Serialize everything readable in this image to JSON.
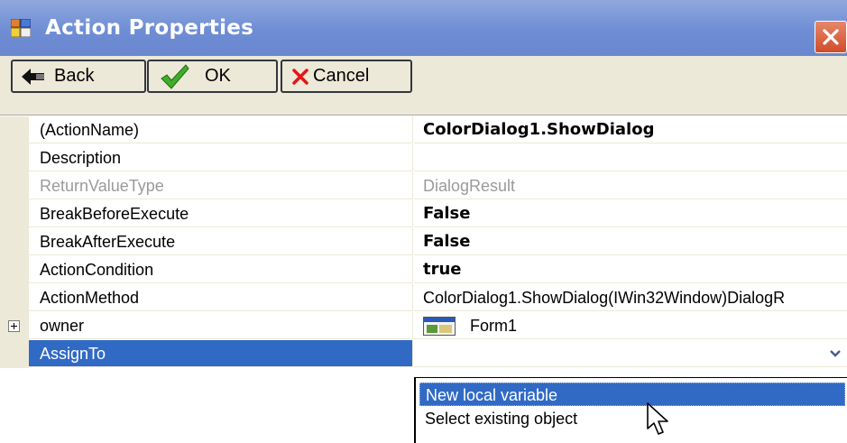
{
  "window": {
    "title": "Action Properties",
    "accent": "#316ac5"
  },
  "toolbar": {
    "back_label": "Back",
    "ok_label": "OK",
    "cancel_label": "Cancel"
  },
  "properties": [
    {
      "name": "(ActionName)",
      "value": "ColorDialog1.ShowDialog"
    },
    {
      "name": "Description",
      "value": ""
    },
    {
      "name": "ReturnValueType",
      "value": "DialogResult"
    },
    {
      "name": "BreakBeforeExecute",
      "value": "False"
    },
    {
      "name": "BreakAfterExecute",
      "value": "False"
    },
    {
      "name": "ActionCondition",
      "value": "true"
    },
    {
      "name": "ActionMethod",
      "value": "ColorDialog1.ShowDialog(IWin32Window)DialogR"
    },
    {
      "name": "owner",
      "value": "Form1",
      "icon": "form-icon"
    },
    {
      "name": "AssignTo",
      "value": ""
    }
  ],
  "dropdown": {
    "items": [
      "New local variable",
      "Select existing object"
    ],
    "highlighted": "New local variable"
  },
  "icons": [
    "app-icon",
    "close-icon",
    "back-arrow-icon",
    "checkmark-icon",
    "cancel-x-icon",
    "expand-icon",
    "form-icon",
    "dropdown-arrow-icon",
    "mouse-cursor-icon"
  ]
}
